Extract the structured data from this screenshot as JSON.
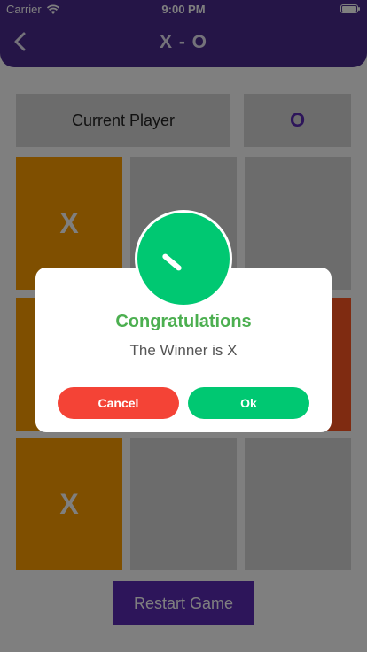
{
  "status_bar": {
    "carrier": "Carrier",
    "time": "9:00 PM"
  },
  "nav": {
    "title": "X - O"
  },
  "info": {
    "label": "Current Player",
    "value": "O"
  },
  "board": [
    {
      "mark": "X",
      "state": "x"
    },
    {
      "mark": "",
      "state": "empty"
    },
    {
      "mark": "",
      "state": "empty"
    },
    {
      "mark": "",
      "state": "x"
    },
    {
      "mark": "",
      "state": "empty"
    },
    {
      "mark": "",
      "state": "o"
    },
    {
      "mark": "X",
      "state": "x"
    },
    {
      "mark": "",
      "state": "empty"
    },
    {
      "mark": "",
      "state": "empty"
    }
  ],
  "restart_label": "Restart Game",
  "dialog": {
    "title": "Congratulations",
    "message": "The Winner is X",
    "cancel_label": "Cancel",
    "ok_label": "Ok"
  },
  "colors": {
    "primary": "#5b2bb5",
    "x_cell": "#ff9f00",
    "o_cell": "#ff5722",
    "success": "#00c872",
    "danger": "#f44336"
  }
}
